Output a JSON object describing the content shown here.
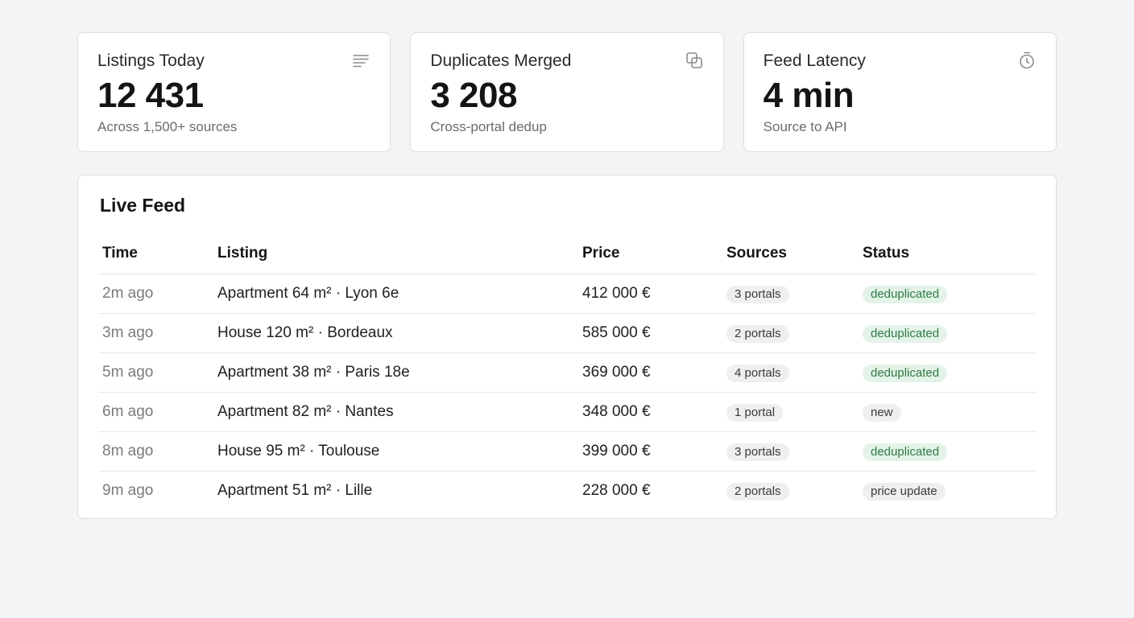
{
  "stats": [
    {
      "label": "Listings Today",
      "value": "12 431",
      "sub": "Across 1,500+ sources",
      "icon": "list-lines-icon"
    },
    {
      "label": "Duplicates Merged",
      "value": "3 208",
      "sub": "Cross-portal dedup",
      "icon": "copy-squares-icon"
    },
    {
      "label": "Feed Latency",
      "value": "4 min",
      "sub": "Source to API",
      "icon": "stopwatch-icon"
    }
  ],
  "feed": {
    "title": "Live Feed",
    "columns": [
      "Time",
      "Listing",
      "Price",
      "Sources",
      "Status"
    ],
    "rows": [
      {
        "time": "2m ago",
        "listing": "Apartment 64 m² · Lyon 6e",
        "price": "412 000 €",
        "sources": "3 portals",
        "status": "deduplicated"
      },
      {
        "time": "3m ago",
        "listing": "House 120 m² · Bordeaux",
        "price": "585 000 €",
        "sources": "2 portals",
        "status": "deduplicated"
      },
      {
        "time": "5m ago",
        "listing": "Apartment 38 m² · Paris 18e",
        "price": "369 000 €",
        "sources": "4 portals",
        "status": "deduplicated"
      },
      {
        "time": "6m ago",
        "listing": "Apartment 82 m² · Nantes",
        "price": "348 000 €",
        "sources": "1 portal",
        "status": "new"
      },
      {
        "time": "8m ago",
        "listing": "House 95 m² · Toulouse",
        "price": "399 000 €",
        "sources": "3 portals",
        "status": "deduplicated"
      },
      {
        "time": "9m ago",
        "listing": "Apartment 51 m² · Lille",
        "price": "228 000 €",
        "sources": "2 portals",
        "status": "price update"
      }
    ]
  },
  "colors": {
    "page_bg": "#f3f4f6",
    "card_bg": "#ffffff",
    "border": "#dcdfe3",
    "status_dedup_bg": "#e4f3e8",
    "status_dedup_text": "#2f7a46",
    "pill_neutral_bg": "#eeeff1"
  }
}
